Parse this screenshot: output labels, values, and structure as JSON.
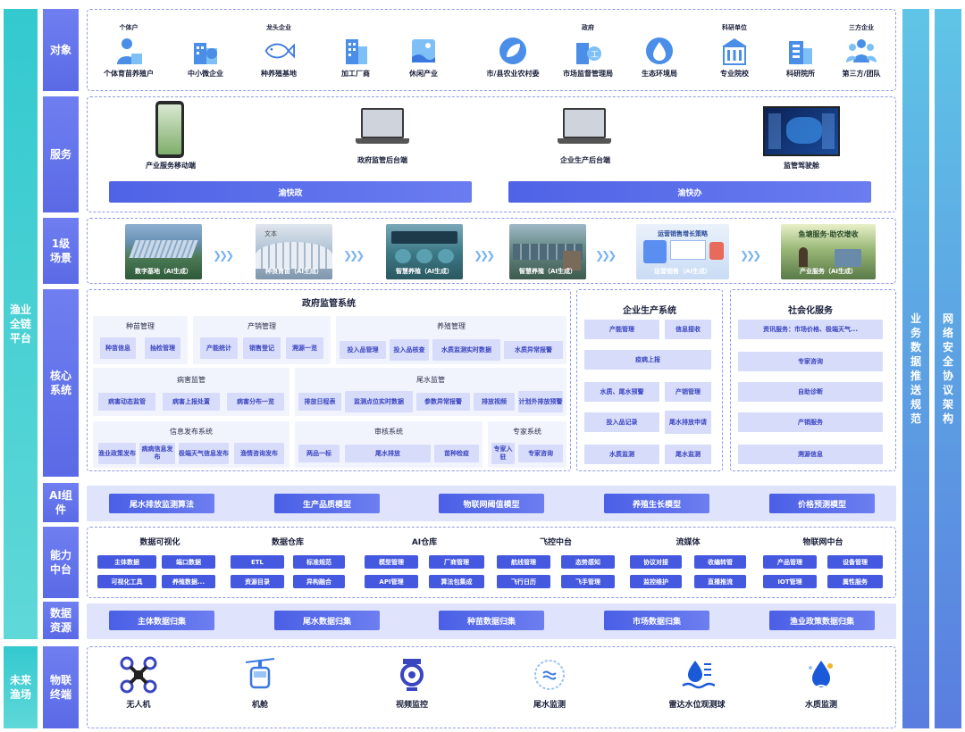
{
  "left": {
    "platform": "渔业全链平台",
    "future": "未来渔场"
  },
  "right": {
    "spec": "业务数据推送规范",
    "security": "网络安全协议架构"
  },
  "rows": {
    "objects": "对象",
    "services": "服务",
    "scenes": "1级场景",
    "core": "核心系统",
    "ai": "AI组件",
    "capability": "能力中台",
    "data": "数据资源",
    "iot": "物联终端"
  },
  "objects": [
    {
      "top": "个体户",
      "label": "个体育苗养殖户",
      "icon": "farmer-icon"
    },
    {
      "top": "",
      "label": "中小微企业",
      "icon": "sme-building-icon"
    },
    {
      "top": "龙头企业",
      "label": "种养殖基地",
      "icon": "fish-icon"
    },
    {
      "top": "",
      "label": "加工厂商",
      "icon": "factory-icon"
    },
    {
      "top": "",
      "label": "休闲产业",
      "icon": "leisure-icon"
    },
    {
      "top": "",
      "label": "市/县农业农村委",
      "icon": "leaf-icon"
    },
    {
      "top": "政府",
      "label": "市场监督管理局",
      "icon": "market-bureau-icon"
    },
    {
      "top": "",
      "label": "生态环境局",
      "icon": "water-drop-icon"
    },
    {
      "top": "科研单位",
      "label": "专业院校",
      "icon": "school-icon"
    },
    {
      "top": "",
      "label": "科研院所",
      "icon": "research-icon"
    },
    {
      "top": "三方企业",
      "label": "第三方/团队",
      "icon": "team-icon"
    }
  ],
  "services": {
    "devices": [
      "产业服务移动端",
      "政府监管后台端",
      "企业生产后台端",
      "监管驾驶舱"
    ],
    "buttons": [
      "渝快政",
      "渝快办"
    ]
  },
  "scenes": [
    {
      "label": "数字基地（AI生成）"
    },
    {
      "label": "种良育苗（AI生成）",
      "overlay": "文本"
    },
    {
      "label": "智慧养殖（AI生成）"
    },
    {
      "label": "智慧养殖（AI生成）"
    },
    {
      "label": "运营销售（AI生成）",
      "overlay": "运营销售增长策略"
    },
    {
      "label": "产业服务（AI生成）",
      "overlay": "鱼塘服务·助农增收"
    }
  ],
  "core": {
    "gov": {
      "title": "政府监管系统",
      "seed": {
        "title": "种苗管理",
        "items": [
          "种苗信息",
          "抽检管理"
        ]
      },
      "sales": {
        "title": "产销管理",
        "items": [
          "产能统计",
          "销售登记",
          "溯源一览"
        ]
      },
      "breed": {
        "title": "养殖管理",
        "items": [
          "投入品管理",
          "投入品核查",
          "水质监测实时数据",
          "水质异常报警"
        ]
      },
      "disease": {
        "title": "病害监管",
        "items": [
          "病害动态监管",
          "病害上报处置",
          "病害分布一览"
        ]
      },
      "tail": {
        "title": "尾水监管",
        "items": [
          "排放日程表",
          "监测点位实时数据",
          "参数异常报警",
          "排放视频",
          "计划外排放预警"
        ]
      },
      "info": {
        "title": "信息发布系统",
        "items": [
          "渔业政策发布",
          "病病信息发布",
          "极端天气信息发布",
          "渔情咨询发布"
        ]
      },
      "audit": {
        "title": "审核系统",
        "items": [
          "两品一标",
          "尾水排放",
          "苗种检疫"
        ]
      },
      "expert": {
        "title": "专家系统",
        "items": [
          "专家入驻",
          "专家咨询"
        ]
      }
    },
    "ent": {
      "title": "企业生产系统",
      "items": [
        "产能管理",
        "信息接收",
        "疫病上报",
        "水质、尾水预警",
        "产销管理",
        "投入品记录",
        "尾水排放申请",
        "水质监测",
        "尾水监测"
      ]
    },
    "social": {
      "title": "社会化服务",
      "items": [
        "资讯服务：市场价格、极端天气...",
        "专家咨询",
        "自助诊断",
        "产销服务",
        "溯源信息"
      ]
    }
  },
  "ai": [
    "尾水排放监测算法",
    "生产品质模型",
    "物联网阈值模型",
    "养殖生长模型",
    "价格预测模型"
  ],
  "capability": [
    {
      "title": "数据可视化",
      "items": [
        "主体数据",
        "端口数据",
        "可视化工具",
        "养殖数据..."
      ]
    },
    {
      "title": "数据仓库",
      "items": [
        "ETL",
        "标准规范",
        "资源目录",
        "异构融合"
      ]
    },
    {
      "title": "AI仓库",
      "items": [
        "模型管理",
        "厂商管理",
        "API管理",
        "算法包集成"
      ]
    },
    {
      "title": "飞控中台",
      "items": [
        "航线管理",
        "态势感知",
        "飞行日历",
        "飞手管理"
      ]
    },
    {
      "title": "流媒体",
      "items": [
        "协议对接",
        "收编转管",
        "监控维护",
        "直播推流"
      ]
    },
    {
      "title": "物联网中台",
      "items": [
        "产品管理",
        "设备管理",
        "IOT管理",
        "属性服务"
      ]
    }
  ],
  "data": [
    "主体数据归集",
    "尾水数据归集",
    "种苗数据归集",
    "市场数据归集",
    "渔业政策数据归集"
  ],
  "terminals": [
    {
      "label": "无人机",
      "icon": "drone-icon"
    },
    {
      "label": "机舱",
      "icon": "cabin-icon"
    },
    {
      "label": "视频监控",
      "icon": "camera-icon"
    },
    {
      "label": "尾水监测",
      "icon": "tailwater-icon"
    },
    {
      "label": "雷达水位观测球",
      "icon": "radar-water-icon"
    },
    {
      "label": "水质监测",
      "icon": "water-quality-icon"
    }
  ],
  "colors": {
    "accent": "#4a5fe6",
    "teal": "#33c9cf",
    "label": "#6474ec",
    "chip": "#d7dcfa"
  }
}
